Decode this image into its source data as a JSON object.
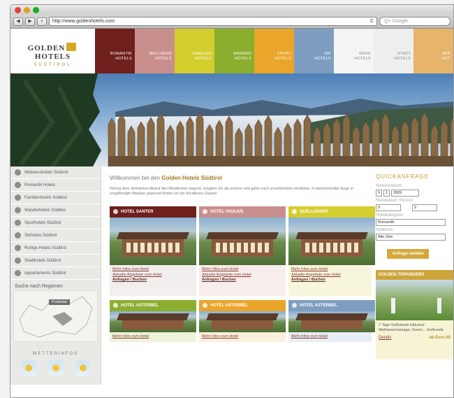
{
  "browser": {
    "url": "http://www.goldenhotels.com",
    "search_placeholder": "Q+ Google",
    "back": "◀",
    "forward": "▶",
    "add": "+",
    "refresh": "C"
  },
  "logo": {
    "brand_left": "GOLDEN",
    "brand_right": "HOTELS",
    "sub": "SÜDTIROL"
  },
  "nav": [
    {
      "line1": "ROMANTIK",
      "line2": "HOTELS",
      "color": "#6f1f1c"
    },
    {
      "line1": "WELLNESS",
      "line2": "HOTELS",
      "color": "#c98f8d"
    },
    {
      "line1": "FAMILIEN",
      "line2": "HOTELS",
      "color": "#d4cd2e"
    },
    {
      "line1": "WANDER",
      "line2": "HOTELS",
      "color": "#8cae2e"
    },
    {
      "line1": "SPORT",
      "line2": "HOTELS",
      "color": "#eaa52a"
    },
    {
      "line1": "SKI",
      "line2": "HOTELS",
      "color": "#7e9dc0"
    },
    {
      "line1": "BERG",
      "line2": "HOTELS",
      "color": "#f4f4f4",
      "dark": true
    },
    {
      "line1": "STADT",
      "line2": "HOTELS",
      "color": "#eeeeee",
      "dark": true
    },
    {
      "line1": "APP",
      "line2": "HOT",
      "color": "#e6b46a"
    }
  ],
  "sidebar": {
    "items": [
      "Wellnesshotels Südtirol",
      "Romantik Hotels",
      "Familienhotels Südtirol",
      "Wanderhotels Südtirol",
      "Sporthotels Südtirol",
      "Skihotels Südtirol",
      "Ruhige Hotels Südtirol",
      "Stadthotels Südtirol",
      "Appartements Südtirol"
    ],
    "region_title": "Suche nach Regionen",
    "map_marker": "Pustertal",
    "weather_title": "WETTERINFOS"
  },
  "main": {
    "welcome_prefix": "Willkommen bei den",
    "welcome_brand": "Golden Hotels Südtirol",
    "intro": "Streng dem definierten Ablauf des Blindtextes folgend, fungiere ich als solcher und gebe mich unverbindlich inhaltslos. In bedrückender Enge in vorgefertigte Masken gepresst fristen ich ein freudloses Dasein.",
    "cards": [
      {
        "title": "HOTEL SANTER",
        "color": "#6f1f1c",
        "bg": "#f3eeee",
        "link1": "Mehr Infos zum Hotel",
        "link2": "Aktuelle Angebote vom Hotel",
        "link3": "Anfragen / Buchen"
      },
      {
        "title": "HOTEL VIGILIUS",
        "color": "#c98f8d",
        "bg": "#f7eded",
        "link1": "Mehr Infos zum Hotel",
        "link2": "Aktuelle Angebote vom Hotel",
        "link3": "Anfragen / Buchen"
      },
      {
        "title": "QUELLENHOF",
        "color": "#d4cd2e",
        "bg": "#f7f5dc",
        "link1": "Mehr Infos zum Hotel",
        "link2": "Aktuelle Angebote vom Hotel",
        "link3": "Anfragen / Buchen"
      },
      {
        "title": "HOTEL ASTERBEL",
        "color": "#8cae2e",
        "bg": "#eef3dc",
        "link1": "Mehr Infos zum Hotel"
      },
      {
        "title": "HOTEL ASTERBEL",
        "color": "#eaa52a",
        "bg": "#fbf0dc",
        "link1": "Mehr Infos zum Hotel"
      },
      {
        "title": "HOTEL ASTERBEL",
        "color": "#7e9dc0",
        "bg": "#e8eef5",
        "link1": "Mehr Infos zum Hotel"
      }
    ]
  },
  "quick": {
    "title": "QUICKANFRAGE",
    "arrival_label": "Anreisedatum:",
    "day": "9",
    "month": "1",
    "year": "2009",
    "nights_label": "Reisedauer: Person",
    "nights": "9",
    "persons": "9",
    "category_label": "Hotelkategorie:",
    "category": "Romantik",
    "place_label": "Hotelorte",
    "place": "Alle Orte",
    "button": "Anfrage senden"
  },
  "golf": {
    "title": "GOLDEN TOPANGEBO",
    "text": "7 Tage Golfurlaub inklusive Wellnessmassage, Green... Golfrunde",
    "link": "Details",
    "price": "ab Euro 65"
  }
}
